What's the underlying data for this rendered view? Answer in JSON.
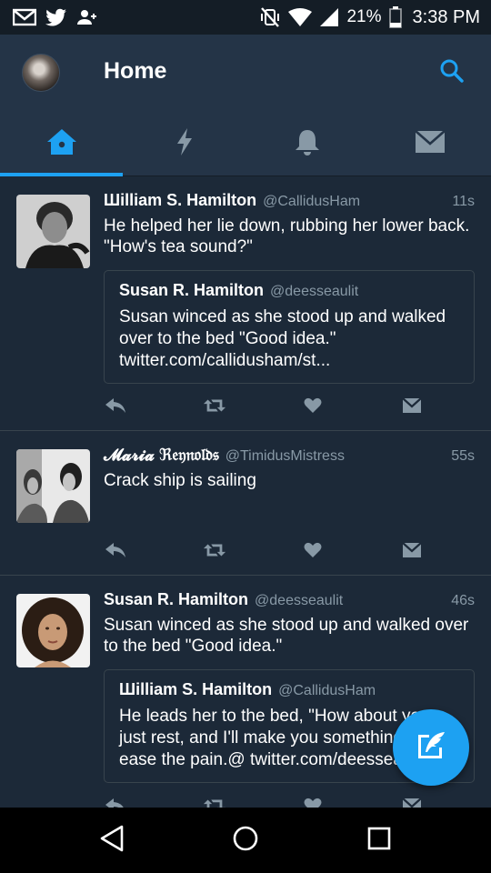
{
  "status_bar": {
    "icons": [
      "gmail-icon",
      "twitter-icon",
      "add-person-icon",
      "vibrate-off-icon",
      "wifi-icon",
      "signal-icon",
      "battery-icon"
    ],
    "battery": "21%",
    "time": "3:38 PM"
  },
  "app_bar": {
    "title": "Home",
    "search_icon": "search-icon",
    "accent_color": "#1da1f2"
  },
  "tabs": [
    {
      "icon": "home-icon",
      "active": true
    },
    {
      "icon": "moments-lightning-icon",
      "active": false
    },
    {
      "icon": "notifications-bell-icon",
      "active": false
    },
    {
      "icon": "messages-envelope-icon",
      "active": false
    }
  ],
  "tweets": [
    {
      "name": "Шilliam S. Hamilton",
      "handle": "@CallidusHam",
      "time": "11s",
      "text": "He helped her lie down, rubbing her lower back. \"How's tea sound?\"",
      "quote": {
        "name": "Susan R. Hamilton",
        "handle": "@deesseaulit",
        "text": "Susan winced as she stood up and walked over to the bed \"Good idea.\"  twitter.com/callidusham/st..."
      }
    },
    {
      "name": "𝓜𝓪𝓻𝓲𝓪 ℜ𝔢𝔶𝔫𝔬𝔩𝔡𝔰",
      "handle": "@TimidusMistress",
      "time": "55s",
      "text": "Crack ship is sailing"
    },
    {
      "name": "Susan R. Hamilton",
      "handle": "@deesseaulit",
      "time": "46s",
      "text": "Susan winced as she stood up and walked over to the bed \"Good idea.\"",
      "quote": {
        "name": "Шilliam S. Hamilton",
        "handle": "@CallidusHam",
        "text": "He leads her to the bed, \"How about you just rest, and I'll make you something to ease the pain.@ twitter.com/deesseaulit/st..."
      }
    }
  ],
  "action_icons": [
    "reply-icon",
    "retweet-icon",
    "like-heart-icon",
    "direct-message-icon"
  ],
  "fab": {
    "icon": "compose-tweet-icon"
  },
  "nav_bar": {
    "icons": [
      "back-triangle-icon",
      "home-circle-icon",
      "recents-square-icon"
    ]
  }
}
